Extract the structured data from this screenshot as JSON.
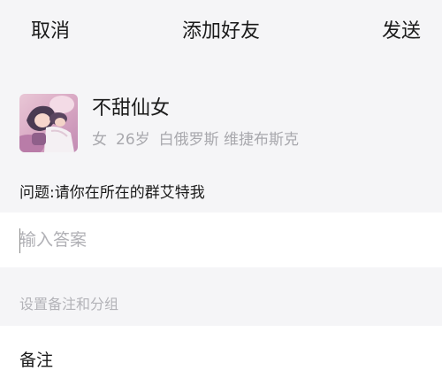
{
  "nav": {
    "cancel_label": "取消",
    "title": "添加好友",
    "send_label": "发送"
  },
  "profile": {
    "name": "不甜仙女",
    "gender": "女",
    "age": "26岁",
    "location": "白俄罗斯 维捷布斯克"
  },
  "question": {
    "text": "问题:请你在所在的群艾特我"
  },
  "answer": {
    "value": "",
    "placeholder": "输入答案"
  },
  "remark_section": {
    "header": "设置备注和分组",
    "remark_label": "备注"
  },
  "colors": {
    "background": "#f5f5f7",
    "row_background": "#ffffff",
    "secondary_text": "#a8a8ad",
    "primary_text": "#1a1a1a"
  }
}
